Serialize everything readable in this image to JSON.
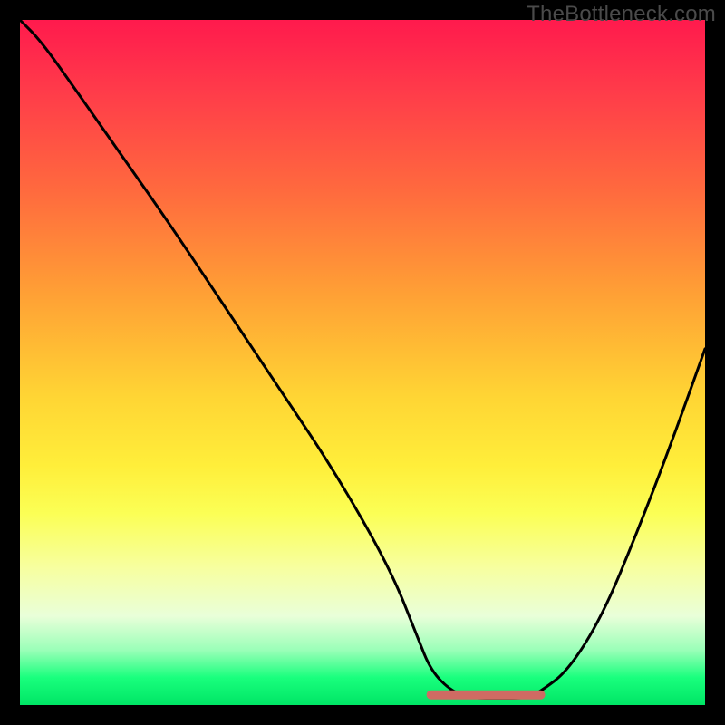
{
  "watermark": "TheBottleneck.com",
  "colors": {
    "frame": "#000000",
    "curve": "#000000",
    "bottom_segment": "#cf6b63",
    "gradient_top": "#ff1a4d",
    "gradient_bottom": "#00e565"
  },
  "chart_data": {
    "type": "line",
    "title": "",
    "xlabel": "",
    "ylabel": "",
    "xlim": [
      0,
      100
    ],
    "ylim": [
      0,
      100
    ],
    "series": [
      {
        "name": "bottleneck-curve",
        "x": [
          0,
          3,
          8,
          15,
          22,
          30,
          38,
          46,
          54,
          58,
          60,
          63,
          66,
          70,
          74,
          76,
          80,
          85,
          90,
          95,
          100
        ],
        "y": [
          100,
          97,
          90,
          80,
          70,
          58,
          46,
          34,
          20,
          10,
          5,
          2,
          1,
          1,
          1,
          2,
          5,
          13,
          25,
          38,
          52
        ]
      }
    ],
    "flat_bottom_segment": {
      "x_start": 60,
      "x_end": 76,
      "y": 1.5,
      "color": "#cf6b63",
      "thickness_px": 10
    },
    "background": {
      "type": "vertical-gradient",
      "stops": [
        {
          "pos": 0.0,
          "color": "#ff1a4d"
        },
        {
          "pos": 0.55,
          "color": "#ffd534"
        },
        {
          "pos": 0.8,
          "color": "#f7ffa0"
        },
        {
          "pos": 1.0,
          "color": "#00e565"
        }
      ]
    }
  }
}
